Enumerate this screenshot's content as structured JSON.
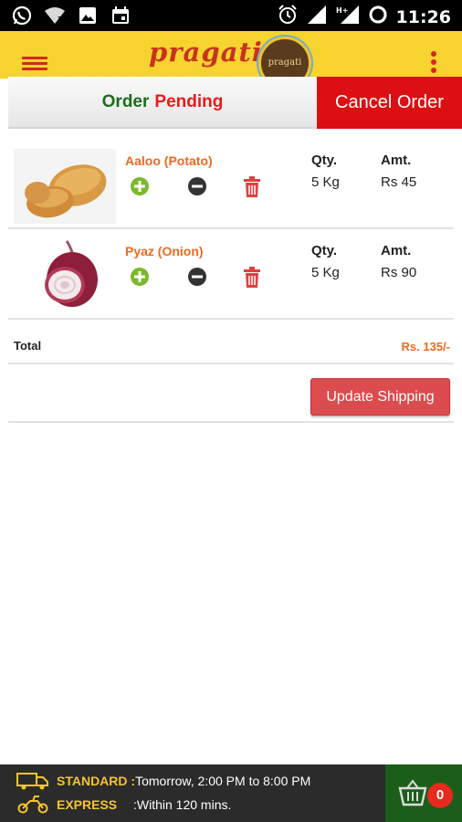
{
  "status_bar": {
    "time": "11:26"
  },
  "app_bar": {
    "logo_text": "pragati",
    "badge_text": "pragati"
  },
  "tabs": {
    "order": "Order",
    "pending": "Pending",
    "cancel": "Cancel Order"
  },
  "columns": {
    "qty": "Qty.",
    "amt": "Amt."
  },
  "items": [
    {
      "name": "Aaloo (Potato)",
      "qty": "5 Kg",
      "amount": "Rs 45"
    },
    {
      "name": "Pyaz (Onion)",
      "qty": "5 Kg",
      "amount": "Rs 90"
    }
  ],
  "total": {
    "label": "Total",
    "value": "Rs. 135/-"
  },
  "update_shipping": "Update Shipping",
  "delivery": {
    "standard_label": "STANDARD :",
    "standard_text": "Tomorrow, 2:00 PM to 8:00 PM",
    "express_label": "EXPRESS",
    "express_text": ":Within 120 mins."
  },
  "cart": {
    "count": "0"
  },
  "colors": {
    "app_bar": "#f6d32e",
    "cancel": "#dc0f12",
    "accent": "#ee6a1e",
    "cart_bg": "#1a5e1a"
  }
}
